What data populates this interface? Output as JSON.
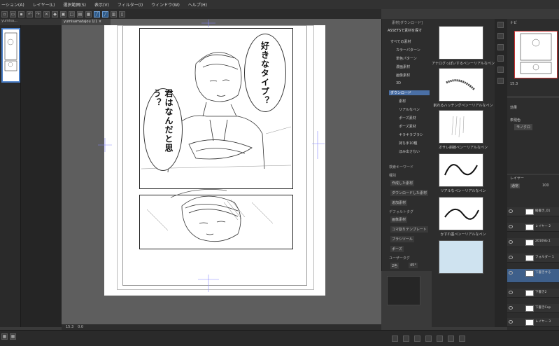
{
  "menu": [
    "ーション(A)",
    "レイヤー(L)",
    "選択範囲(S)",
    "表示(V)",
    "フィルター(I)",
    "ウィンドウ(W)",
    "ヘルプ(H)"
  ],
  "document": {
    "tab_label": "yumisamatajou 1/1 ×",
    "zoom": "15.3",
    "angle": "0.0"
  },
  "speech": {
    "bubble1": "好きなタイプ？",
    "bubble2": "君はなんだと思う？"
  },
  "materials": {
    "panel_title": "素材[ダウンロード]",
    "assets_label": "ASSETSで素材を探す",
    "tree": [
      "すべての素材",
      "カラーパターン",
      "単色パターン",
      "漫画素材",
      "画像素材",
      "3D",
      "ダウンロード",
      "素材",
      "リアルなペン",
      "ポーズ素材",
      "ポーズ素材",
      "キラキラブラシ",
      "持ち手10種",
      "ほみ出さない"
    ],
    "search_label": "検索キーワード",
    "type_label": "種別",
    "type_items": [
      "作成した素材",
      "ダウンロードした素材",
      "追加素材"
    ],
    "default_tag_label": "デフォルトタグ",
    "default_tags": [
      "画像素材",
      "コマ割りテンプレート",
      "ブラシツール",
      "ポーズ"
    ],
    "user_tag_label": "ユーザータグ",
    "user_tags": [
      "2色",
      "45°"
    ],
    "items": [
      {
        "label": "アナログっぽいするペンーリアルなペン"
      },
      {
        "label": "削れるハッチングペンーリアルなペン"
      },
      {
        "label": "オサレ斜線ペンーリアルなペン"
      },
      {
        "label": "リアルなペンーリアルなペン"
      },
      {
        "label": "かすれ墨ペンーリアルなペン"
      }
    ]
  },
  "navigator": {
    "zoom": "15.3",
    "tab": "ナビ"
  },
  "tone": {
    "effect_label": "効果",
    "expression_label": "表現色",
    "color_mode": "モノクロ"
  },
  "layers": {
    "panel_label": "レイヤー",
    "blend": "通常",
    "opacity": "100",
    "items": [
      {
        "name": "100 %",
        "sub": "縦書き_01"
      },
      {
        "name": "100 %通常",
        "sub": "レイヤー 2"
      },
      {
        "name": "100 %通常",
        "sub": "2016No.1"
      },
      {
        "name": "100 %通常",
        "sub": "フォルダー 1"
      },
      {
        "name": "100 %通常",
        "sub": "下書きする"
      },
      {
        "name": "100 %",
        "sub": "下書き2"
      },
      {
        "name": "100 %",
        "sub": "下書きCop"
      },
      {
        "name": "100 %",
        "sub": "レイヤー 3"
      }
    ]
  }
}
